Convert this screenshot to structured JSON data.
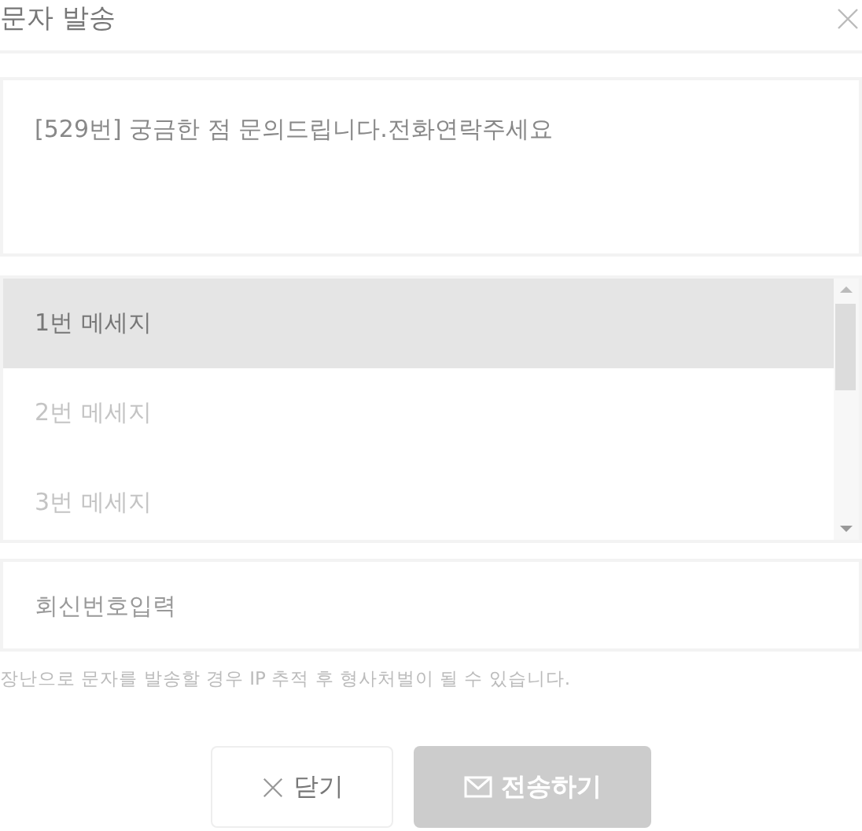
{
  "dialog": {
    "title": "문자 발송"
  },
  "message": {
    "value": "[529번] 궁금한 점 문의드립니다.전화연락주세요"
  },
  "templates": [
    {
      "label": "1번 메세지",
      "selected": true
    },
    {
      "label": "2번 메세지",
      "selected": false
    },
    {
      "label": "3번 메세지",
      "selected": false
    }
  ],
  "reply_number": {
    "placeholder": "회신번호입력"
  },
  "notice": "장난으로 문자를 발송할 경우 IP 추적 후 형사처벌이 될 수 있습니다.",
  "buttons": [
    {
      "kind": "close",
      "label": "닫기",
      "disabled": false
    },
    {
      "kind": "send",
      "label": "전송하기",
      "disabled": true
    }
  ]
}
